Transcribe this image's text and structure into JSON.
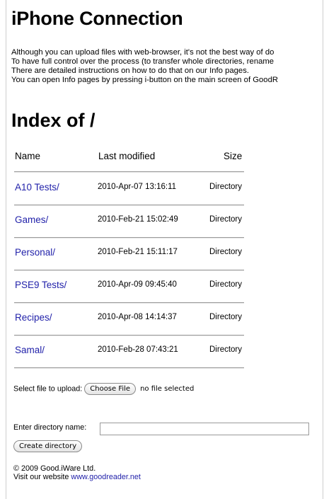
{
  "header": {
    "title": "iPhone Connection"
  },
  "intro": {
    "lines": [
      "Although you can upload files with web-browser, it's not the best way of do",
      "To have full control over the process (to transfer whole directories, rename",
      "There are detailed instructions on how to do that on our Info pages.",
      "You can open Info pages by pressing i-button on the main screen of GoodR"
    ]
  },
  "index": {
    "title": "Index of /",
    "columns": {
      "name": "Name",
      "last_modified": "Last modified",
      "size": "Size"
    },
    "rows": [
      {
        "name": "A10 Tests/",
        "modified": "2010-Apr-07 13:16:11",
        "size": "Directory"
      },
      {
        "name": "Games/",
        "modified": "2010-Feb-21 15:02:49",
        "size": "Directory"
      },
      {
        "name": "Personal/",
        "modified": "2010-Feb-21 15:11:17",
        "size": "Directory"
      },
      {
        "name": "PSE9 Tests/",
        "modified": "2010-Apr-09 09:45:40",
        "size": "Directory"
      },
      {
        "name": "Recipes/",
        "modified": "2010-Apr-08 14:14:37",
        "size": "Directory"
      },
      {
        "name": "Samal/",
        "modified": "2010-Feb-28 07:43:21",
        "size": "Directory"
      }
    ]
  },
  "upload": {
    "label": "Select file to upload:",
    "button_label": "Choose File",
    "status": "no file selected"
  },
  "create_dir": {
    "label": "Enter directory name:",
    "value": "",
    "button_label": "Create directory"
  },
  "footer": {
    "copyright": "© 2009 Good.iWare Ltd.",
    "visit_text": "Visit our website",
    "link_text": "www.goodreader.net"
  },
  "colors": {
    "link": "#2222aa"
  }
}
